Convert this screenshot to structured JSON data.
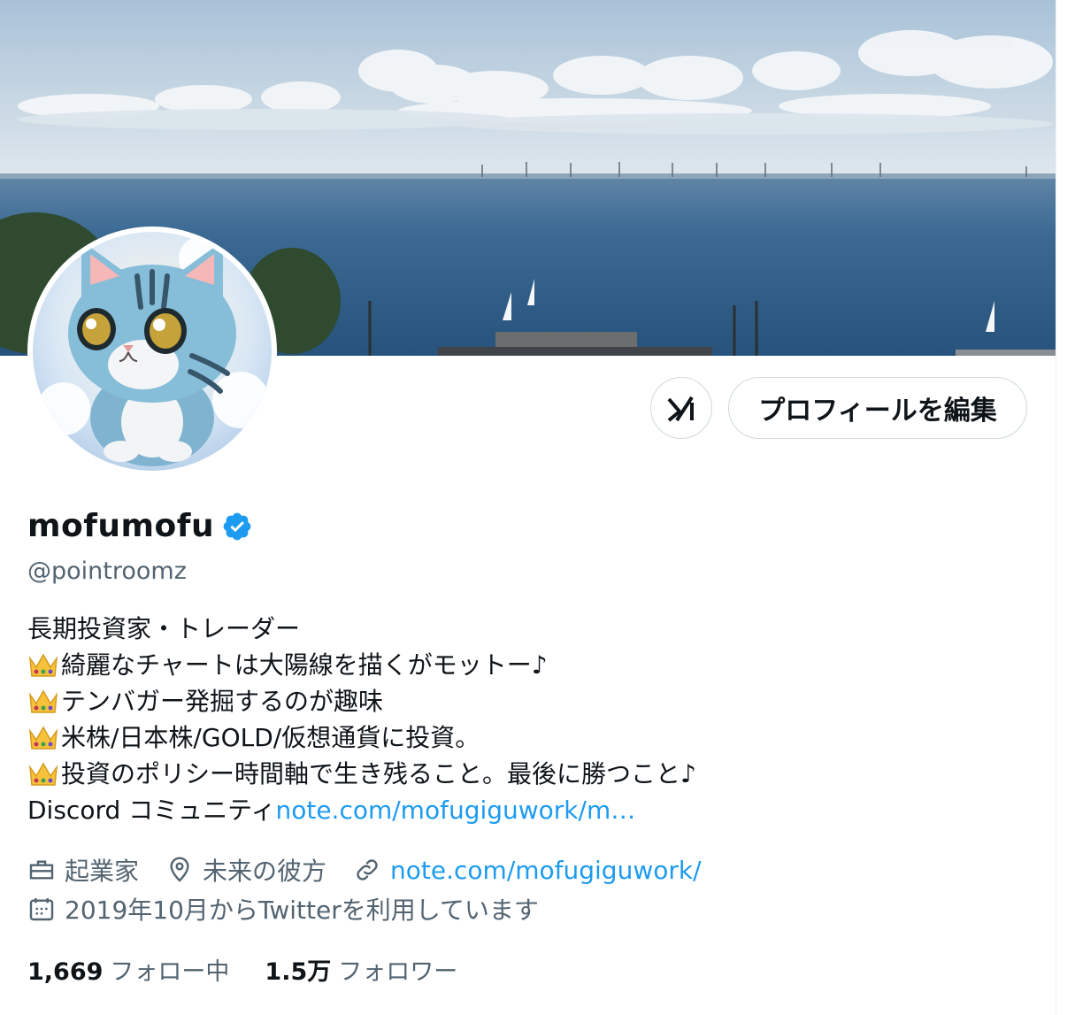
{
  "colors": {
    "accent": "#1d9bf0",
    "text_primary": "#0f1419",
    "text_secondary": "#536471",
    "border": "#cfd9de",
    "verified": "#1d9bf0",
    "sky": "#b8cde0",
    "sea": "#2f5d86"
  },
  "header": {
    "grok_icon": "grok-icon",
    "edit_profile_label": "プロフィールを編集"
  },
  "profile": {
    "display_name": "mofumofu",
    "verified_icon": "verified-badge-icon",
    "handle": "@pointroomz"
  },
  "bio": {
    "line1": "長期投資家・トレーダー",
    "line2": "綺麗なチャートは大陽線を描くがモットー♪",
    "line3": "テンバガー発掘するのが趣味",
    "line4": "米株/日本株/GOLD/仮想通貨に投資。",
    "line5": "投資のポリシー時間軸で生き残ること。最後に勝つこと♪",
    "line6_text": "Discord コミュニティ",
    "line6_link": "note.com/mofugiguwork/m…",
    "crown_icon": "crown-emoji-icon"
  },
  "meta": {
    "profession_icon": "briefcase-icon",
    "profession": "起業家",
    "location_icon": "location-pin-icon",
    "location": "未来の彼方",
    "link_icon": "link-icon",
    "website": "note.com/mofugiguwork/",
    "calendar_icon": "calendar-icon",
    "joined": "2019年10月からTwitterを利用しています"
  },
  "stats": {
    "following_count": "1,669",
    "following_label": "フォロー中",
    "followers_count": "1.5万",
    "followers_label": "フォロワー"
  }
}
